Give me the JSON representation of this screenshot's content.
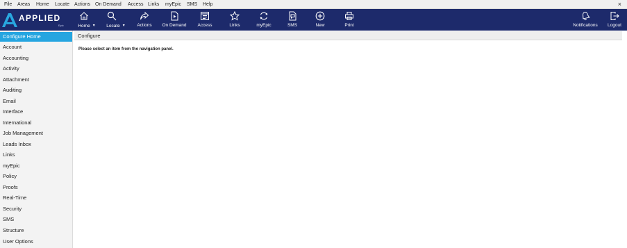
{
  "menubar": {
    "items": [
      "File",
      "Areas",
      "Home",
      "Locate",
      "Actions",
      "On Demand",
      "Access",
      "Links",
      "myEpic",
      "SMS",
      "Help"
    ],
    "close_glyph": "×"
  },
  "logo": {
    "text": "APPLIED",
    "subtext": "Epic"
  },
  "toolbar": {
    "buttons": [
      {
        "label": "Home",
        "icon": "home-icon",
        "dropdown": true
      },
      {
        "label": "Locate",
        "icon": "search-icon",
        "dropdown": true
      },
      {
        "label": "Actions",
        "icon": "share-arrow-icon"
      },
      {
        "label": "On Demand",
        "icon": "document-play-icon"
      },
      {
        "label": "Access",
        "icon": "window-list-icon"
      },
      {
        "label": "Links",
        "icon": "star-icon"
      },
      {
        "label": "myEpic",
        "icon": "refresh-circle-icon"
      },
      {
        "label": "SMS",
        "icon": "sms-document-icon"
      },
      {
        "label": "New",
        "icon": "plus-circle-icon"
      },
      {
        "label": "Print",
        "icon": "printer-icon"
      },
      {
        "label": "Notifications",
        "icon": "bell-icon"
      },
      {
        "label": "Logout",
        "icon": "logout-icon"
      }
    ]
  },
  "sidebar": {
    "items": [
      "Configure Home",
      "Account",
      "Accounting",
      "Activity",
      "Attachment",
      "Auditing",
      "Email",
      "Interface",
      "International",
      "Job Management",
      "Leads Inbox",
      "Links",
      "myEpic",
      "Policy",
      "Proofs",
      "Real-Time",
      "Security",
      "SMS",
      "Structure",
      "User Options"
    ],
    "active": "Configure Home"
  },
  "main": {
    "title": "Configure",
    "message": "Please select an item from the navigation panel."
  },
  "colors": {
    "toolbar_bg": "#1d2a6b",
    "active_nav": "#25a5e0",
    "logo_accent": "#29a8e0"
  }
}
